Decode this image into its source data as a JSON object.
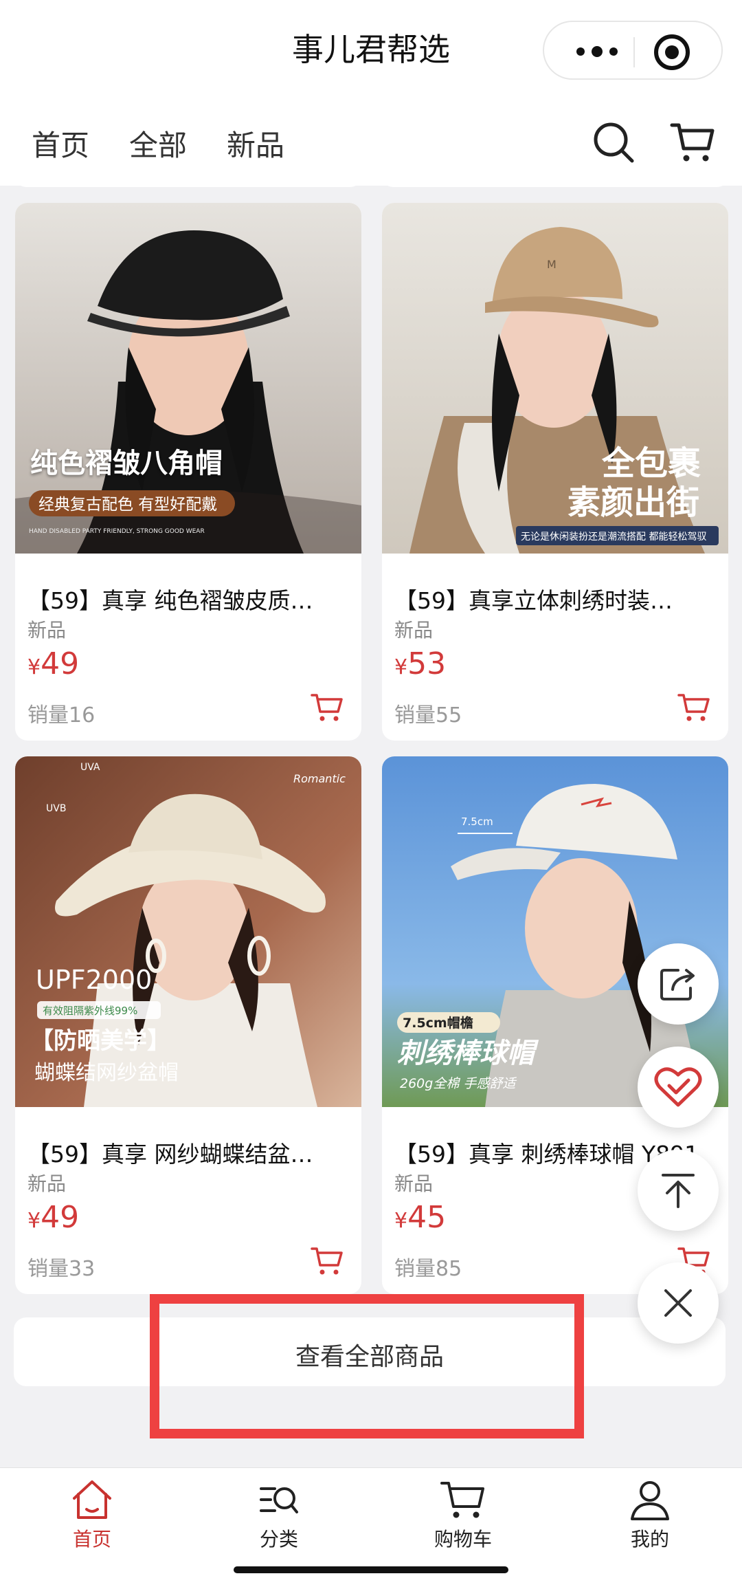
{
  "app_title": "事儿君帮选",
  "tabs": [
    "首页",
    "全部",
    "新品"
  ],
  "products": [
    {
      "title": "【59】真享 纯色褶皱皮质…",
      "tag": "新品",
      "currency": "¥",
      "price": "49",
      "sales": "销量16",
      "image_text": {
        "main": "纯色褶皱八角帽",
        "sub": "经典复古配色 有型好配戴",
        "small": "HAND DISABLED PARTY FRIENDLY, STRONG GOOD WEAR"
      }
    },
    {
      "title": "【59】真享立体刺绣时装…",
      "tag": "新品",
      "currency": "¥",
      "price": "53",
      "sales": "销量55",
      "image_text": {
        "main": "全包裹",
        "main2": "素颜出街",
        "sub": "无论是休闲装扮还是潮流搭配 都能轻松驾驭"
      }
    },
    {
      "title": "【59】真享 网纱蝴蝶结盆…",
      "tag": "新品",
      "currency": "¥",
      "price": "49",
      "sales": "销量33",
      "image_text": {
        "uva": "UVA",
        "uvb": "UVB",
        "brand": "Romantic",
        "main": "UPF2000",
        "badge": "有效阻隔紫外线99%",
        "sub": "【防晒美学】",
        "sub2": "蝴蝶结网纱盆帽"
      }
    },
    {
      "title": "【59】真享 刺绣棒球帽 Y891",
      "tag": "新品",
      "currency": "¥",
      "price": "45",
      "sales": "销量85",
      "image_text": {
        "measure": "7.5cm",
        "badge": "7.5cm帽檐",
        "main": "刺绣棒球帽",
        "sub": "260g全棉 手感舒适"
      }
    }
  ],
  "view_all_label": "查看全部商品",
  "bottom_nav": [
    "首页",
    "分类",
    "购物车",
    "我的"
  ],
  "colors": {
    "accent": "#c8322f",
    "price": "#d23a3a",
    "highlight_frame": "#ee4141"
  },
  "icons": [
    "more-icon",
    "target-icon",
    "search-icon",
    "cart-icon",
    "share-icon",
    "favorite-icon",
    "back-to-top-icon",
    "close-icon",
    "home-icon",
    "category-icon",
    "profile-icon"
  ]
}
